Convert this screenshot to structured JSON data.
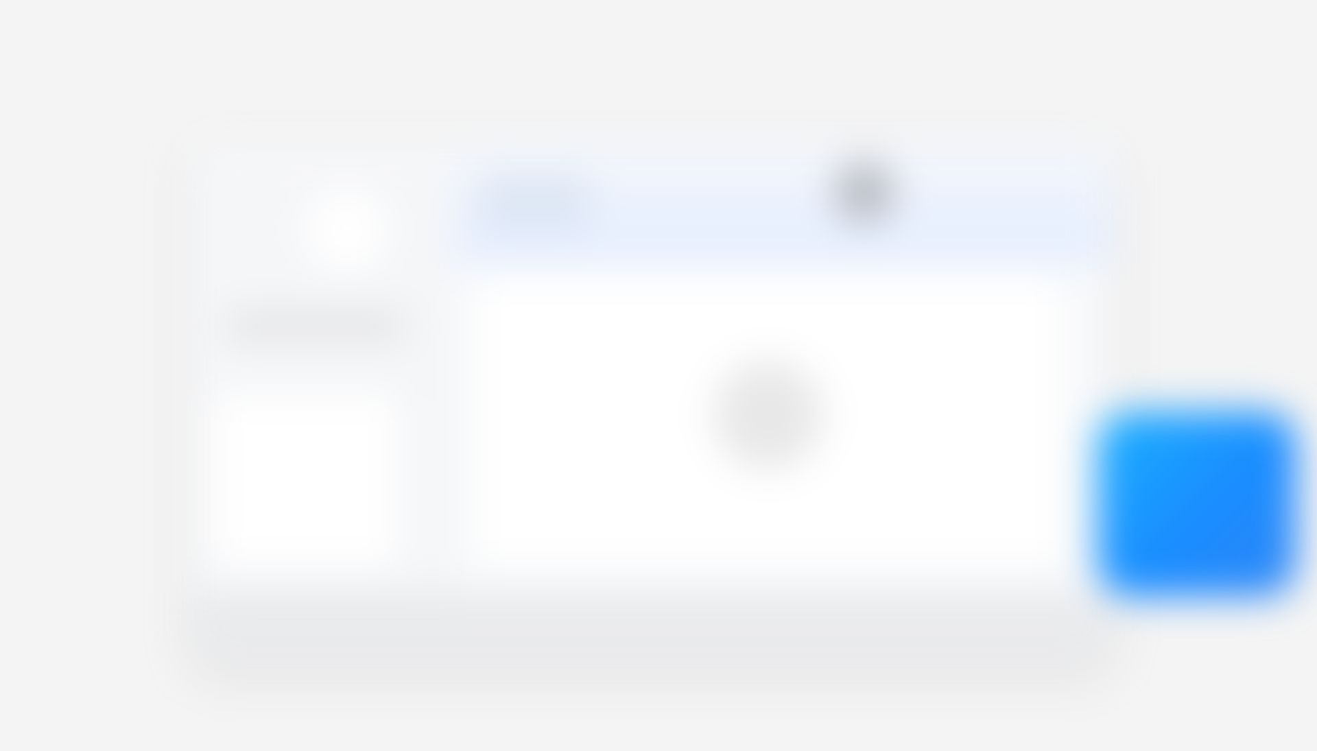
{
  "colors": {
    "background": "#f4f4f4",
    "window": "#f7f8fa",
    "header_tint": "#e6efff",
    "avatar": "#b9bcc3",
    "primary_accent": "#1a8cff"
  },
  "icons": {
    "action_button": "plus-icon"
  }
}
